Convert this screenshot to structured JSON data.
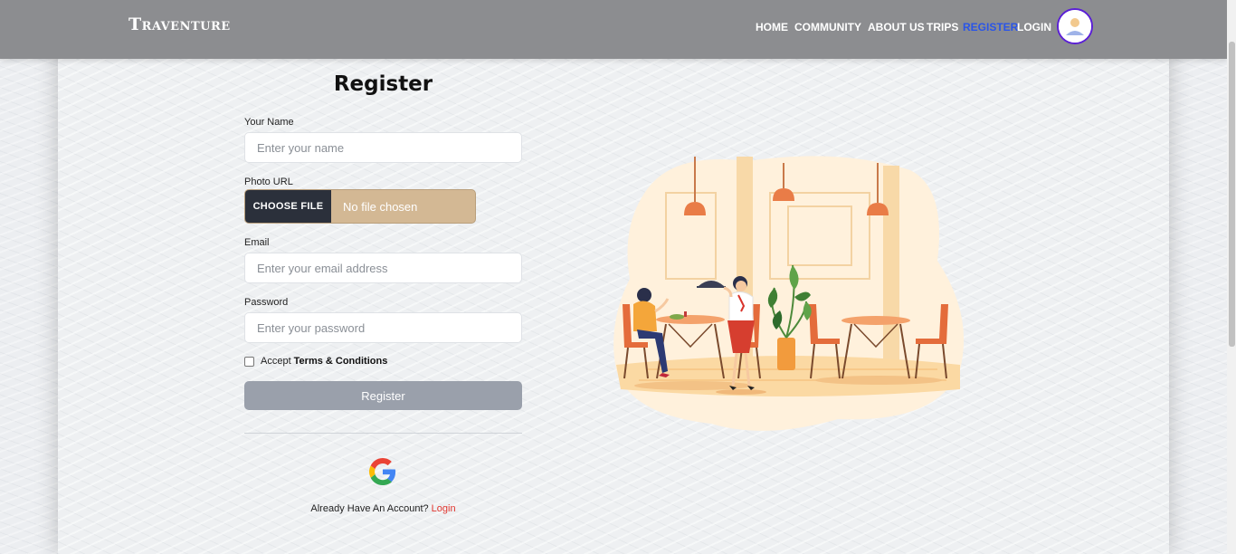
{
  "navbar": {
    "brand": "Traventure",
    "links": [
      {
        "label": "HOME",
        "active": false
      },
      {
        "label": "COMMUNITY",
        "active": false
      },
      {
        "label": "ABOUT US",
        "active": false
      },
      {
        "label": "TRIPS",
        "active": false
      },
      {
        "label": "REGISTER",
        "active": true
      },
      {
        "label": "LOGIN",
        "active": false
      }
    ],
    "avatar_icon": "user-avatar-icon"
  },
  "form": {
    "title": "Register",
    "name_label": "Your Name",
    "name_placeholder": "Enter your name",
    "photo_label": "Photo URL",
    "file_button": "CHOOSE FILE",
    "file_status": "No file chosen",
    "email_label": "Email",
    "email_placeholder": "Enter your email address",
    "password_label": "Password",
    "password_placeholder": "Enter your password",
    "terms_prefix": "Accept",
    "terms_link": "Terms & Conditions",
    "submit_label": "Register",
    "google_icon": "google-icon",
    "login_prompt": "Already Have An Account?",
    "login_link": "Login"
  },
  "colors": {
    "navbar_bg": "#8c8d90",
    "active_link": "#2a55e8",
    "avatar_ring": "#5b1fd6",
    "file_btn_bg": "#2b303b",
    "file_field_bg": "#d3b894",
    "submit_bg": "#9aa0ab",
    "login_link": "#e0362f"
  }
}
